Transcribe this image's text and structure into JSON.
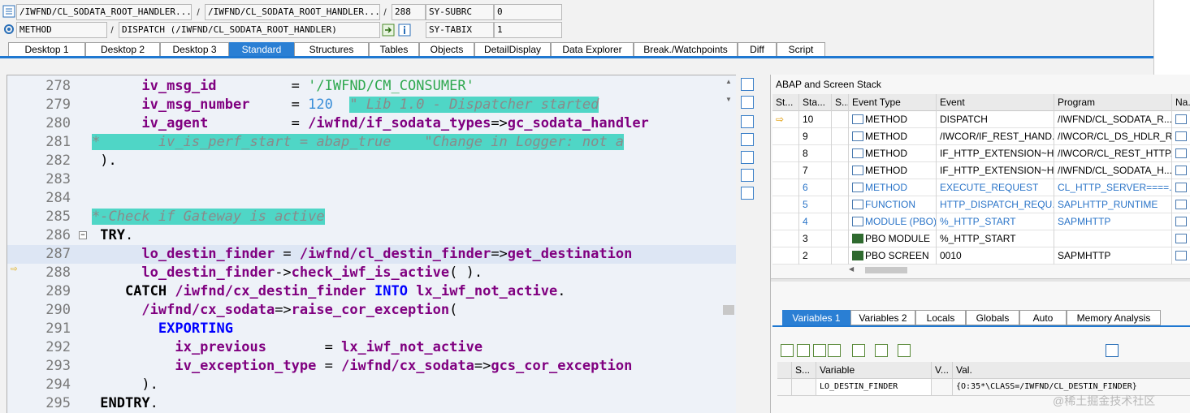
{
  "header": {
    "row1": {
      "program": "/IWFND/CL_SODATA_ROOT_HANDLER...",
      "include": "/IWFND/CL_SODATA_ROOT_HANDLER...",
      "line": "288",
      "sysvar_name": "SY-SUBRC",
      "sysvar_value": "0",
      "sep": "/"
    },
    "row2": {
      "event_type": "METHOD",
      "event": "DISPATCH (/IWFND/CL_SODATA_ROOT_HANDLER)",
      "sysvar_name": "SY-TABIX",
      "sysvar_value": "1",
      "sep": "/"
    }
  },
  "tabs": [
    "Desktop 1",
    "Desktop 2",
    "Desktop 3",
    "Standard",
    "Structures",
    "Tables",
    "Objects",
    "DetailDisplay",
    "Data Explorer",
    "Break./Watchpoints",
    "Diff",
    "Script"
  ],
  "active_tab": "Standard",
  "source": {
    "lines": [
      {
        "n": "278",
        "parts": [
          [
            "",
            "      "
          ],
          [
            "id",
            "iv_msg_id"
          ],
          [
            "",
            "         = "
          ],
          [
            "str",
            "'/IWFND/CM_CONSUMER'"
          ]
        ]
      },
      {
        "n": "279",
        "parts": [
          [
            "",
            "      "
          ],
          [
            "id",
            "iv_msg_number"
          ],
          [
            "",
            "     = "
          ],
          [
            "num",
            "120"
          ],
          [
            "",
            "  "
          ],
          [
            "cmthl",
            "\" Lib 1.0 - Dispatcher started"
          ]
        ]
      },
      {
        "n": "280",
        "parts": [
          [
            "",
            "      "
          ],
          [
            "id",
            "iv_agent"
          ],
          [
            "",
            "          = "
          ],
          [
            "id",
            "/iwfnd/if_sodata_types"
          ],
          [
            "",
            "=>"
          ],
          [
            "id",
            "gc_sodata_handler"
          ]
        ]
      },
      {
        "n": "281",
        "parts": [
          [
            "cmthl",
            "*       iv_is_perf_start = abap_true    \"Change in Logger: not a"
          ]
        ]
      },
      {
        "n": "282",
        "parts": [
          [
            "",
            " )."
          ]
        ]
      },
      {
        "n": "283",
        "parts": [
          [
            "",
            ""
          ]
        ]
      },
      {
        "n": "284",
        "parts": [
          [
            "",
            ""
          ]
        ]
      },
      {
        "n": "285",
        "parts": [
          [
            "cmthl",
            "*-Check if Gateway is active"
          ]
        ]
      },
      {
        "n": "286",
        "parts": [
          [
            "",
            " "
          ],
          [
            "kb",
            "TRY"
          ],
          [
            "",
            "."
          ]
        ]
      },
      {
        "n": "287",
        "parts": [
          [
            "",
            "      "
          ],
          [
            "id",
            "lo_destin_finder"
          ],
          [
            "",
            " = "
          ],
          [
            "id",
            "/iwfnd/cl_destin_finder"
          ],
          [
            "",
            "=>"
          ],
          [
            "id",
            "get_destination"
          ]
        ]
      },
      {
        "n": "288",
        "parts": [
          [
            "",
            "      "
          ],
          [
            "id",
            "lo_destin_finder"
          ],
          [
            "",
            "->"
          ],
          [
            "id",
            "check_iwf_is_active"
          ],
          [
            "",
            "( )."
          ]
        ]
      },
      {
        "n": "289",
        "parts": [
          [
            "",
            "    "
          ],
          [
            "kb",
            "CATCH"
          ],
          [
            "",
            " "
          ],
          [
            "id",
            "/iwfnd/cx_destin_finder"
          ],
          [
            "",
            " "
          ],
          [
            "kw",
            "INTO"
          ],
          [
            "",
            " "
          ],
          [
            "id",
            "lx_iwf_not_active"
          ],
          [
            "",
            "."
          ]
        ]
      },
      {
        "n": "290",
        "parts": [
          [
            "",
            "      "
          ],
          [
            "id",
            "/iwfnd/cx_sodata"
          ],
          [
            "",
            "=>"
          ],
          [
            "id",
            "raise_cor_exception"
          ],
          [
            "",
            "("
          ]
        ]
      },
      {
        "n": "291",
        "parts": [
          [
            "",
            "        "
          ],
          [
            "kw",
            "EXPORTING"
          ]
        ]
      },
      {
        "n": "292",
        "parts": [
          [
            "",
            "          "
          ],
          [
            "id",
            "ix_previous"
          ],
          [
            "",
            "       = "
          ],
          [
            "id",
            "lx_iwf_not_active"
          ]
        ]
      },
      {
        "n": "293",
        "parts": [
          [
            "",
            "          "
          ],
          [
            "id",
            "iv_exception_type"
          ],
          [
            "",
            " = "
          ],
          [
            "id",
            "/iwfnd/cx_sodata"
          ],
          [
            "",
            "=>"
          ],
          [
            "id",
            "gcs_cor_exception"
          ]
        ]
      },
      {
        "n": "294",
        "parts": [
          [
            "",
            "      )."
          ]
        ]
      },
      {
        "n": "295",
        "parts": [
          [
            "",
            " "
          ],
          [
            "kb",
            "ENDTRY"
          ],
          [
            "",
            "."
          ]
        ]
      }
    ]
  },
  "stack": {
    "title": "ABAP and Screen Stack",
    "columns": [
      "St...",
      "Sta...",
      "S...",
      "Event Type",
      "Event",
      "Program",
      "Na..."
    ],
    "rows": [
      {
        "level": "10",
        "type": "METHOD",
        "event": "DISPATCH",
        "program": "/IWFND/CL_SODATA_R...",
        "blue": false,
        "current": true,
        "pbo": false
      },
      {
        "level": "9",
        "type": "METHOD",
        "event": "/IWCOR/IF_REST_HAND...",
        "program": "/IWCOR/CL_DS_HDLR_R...",
        "blue": false,
        "current": false,
        "pbo": false
      },
      {
        "level": "8",
        "type": "METHOD",
        "event": "IF_HTTP_EXTENSION~H...",
        "program": "/IWCOR/CL_REST_HTTP...",
        "blue": false,
        "current": false,
        "pbo": false
      },
      {
        "level": "7",
        "type": "METHOD",
        "event": "IF_HTTP_EXTENSION~H...",
        "program": "/IWFND/CL_SODATA_H...",
        "blue": false,
        "current": false,
        "pbo": false
      },
      {
        "level": "6",
        "type": "METHOD",
        "event": "EXECUTE_REQUEST",
        "program": "CL_HTTP_SERVER====...",
        "blue": true,
        "current": false,
        "pbo": false
      },
      {
        "level": "5",
        "type": "FUNCTION",
        "event": "HTTP_DISPATCH_REQU...",
        "program": "SAPLHTTP_RUNTIME",
        "blue": true,
        "current": false,
        "pbo": false
      },
      {
        "level": "4",
        "type": "MODULE (PBO)",
        "event": "%_HTTP_START",
        "program": "SAPMHTTP",
        "blue": true,
        "current": false,
        "pbo": false
      },
      {
        "level": "3",
        "type": "PBO MODULE",
        "event": "%_HTTP_START",
        "program": "",
        "blue": false,
        "current": false,
        "pbo": true
      },
      {
        "level": "2",
        "type": "PBO SCREEN",
        "event": "0010",
        "program": "SAPMHTTP",
        "blue": false,
        "current": false,
        "pbo": true
      }
    ]
  },
  "var_tabs": [
    "Variables 1",
    "Variables 2",
    "Locals",
    "Globals",
    "Auto",
    "Memory Analysis"
  ],
  "active_var_tab": "Variables 1",
  "variables": {
    "columns": [
      "S...",
      "Variable",
      "V...",
      "Val."
    ],
    "rows": [
      {
        "variable": "LO_DESTIN_FINDER",
        "value": "{O:35*\\CLASS=/IWFND/CL_DESTIN_FINDER}"
      }
    ]
  },
  "watermark": "@稀土掘金技术社区"
}
